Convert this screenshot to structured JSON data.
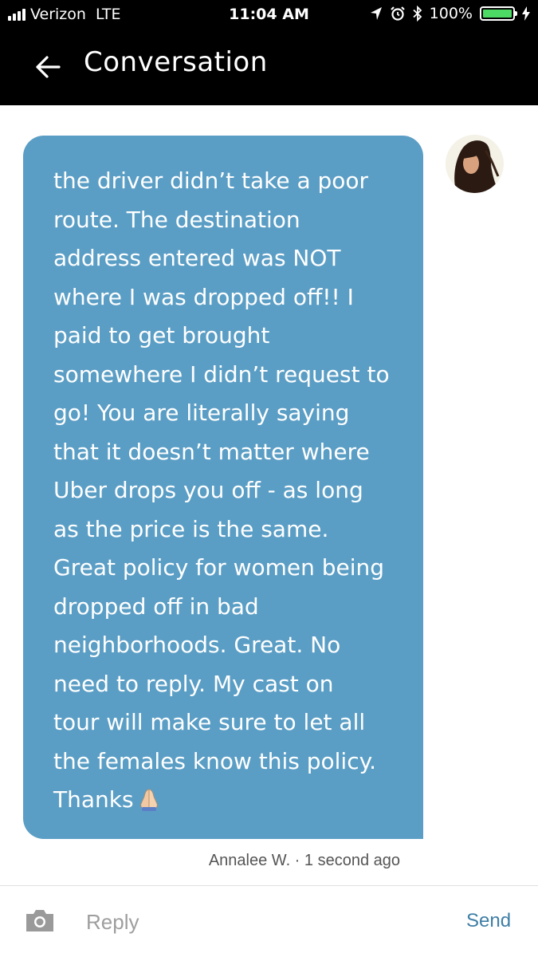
{
  "status_bar": {
    "carrier": "Verizon",
    "network": "LTE",
    "time": "11:04 AM",
    "battery_percent": "100%",
    "battery_level": 1.0,
    "icons": [
      "location-arrow-icon",
      "alarm-icon",
      "bluetooth-icon",
      "charging-bolt-icon"
    ]
  },
  "header": {
    "title": "Conversation",
    "back_icon": "arrow-left-icon"
  },
  "message": {
    "lines": [
      "the driver didn’t take a poor",
      "route. The destination",
      "address entered was NOT",
      "where I was dropped off!! I",
      "paid to get brought",
      "somewhere I didn’t request to",
      "go! You are literally saying",
      "that it doesn’t matter where",
      "Uber drops you off - as long",
      "as the price is the same.",
      "Great policy for women being",
      "dropped off in bad",
      "neighborhoods. Great. No",
      "need to reply. My cast on",
      "tour will make sure to let all",
      "the females know this policy.",
      "Thanks"
    ],
    "trailing_emoji": "folded-hands-emoji",
    "sender": "Annalee W.",
    "separator": "·",
    "time_ago": "1 second ago",
    "meta": "Annalee W. · 1 second ago",
    "bubble_color": "#5b9ec5"
  },
  "reply_bar": {
    "camera_icon": "camera-icon",
    "placeholder": "Reply",
    "send_label": "Send",
    "send_color": "#3f7fa6"
  }
}
